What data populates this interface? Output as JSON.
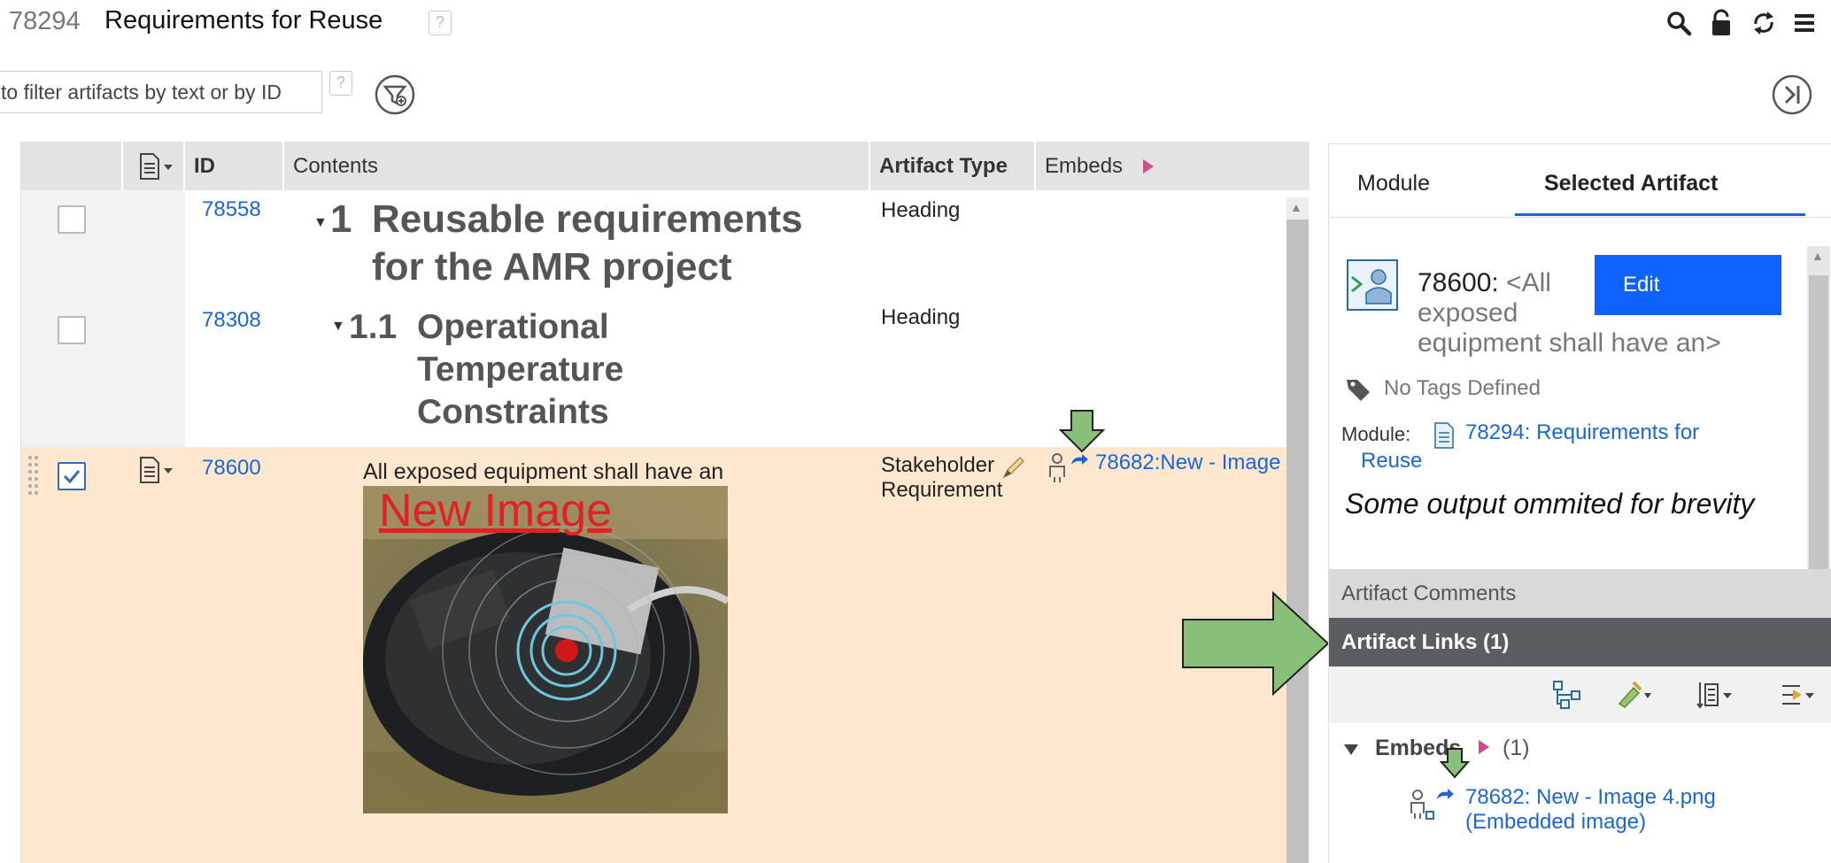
{
  "header": {
    "module_id": "78294",
    "module_title": "Requirements for Reuse",
    "help_label": "?"
  },
  "filter": {
    "placeholder": "to filter artifacts by text or by ID",
    "help_label": "?"
  },
  "grid": {
    "columns": {
      "id": "ID",
      "contents": "Contents",
      "artifact_type": "Artifact Type",
      "embeds": "Embeds"
    },
    "rows": [
      {
        "id": "78558",
        "number": "1",
        "text_line1": "Reusable requirements",
        "text_line2": "for the AMR project",
        "type": "Heading",
        "checked": false
      },
      {
        "id": "78308",
        "number": "1.1",
        "text_line1": "Operational",
        "text_line2": "Temperature",
        "text_line3": "Constraints",
        "type": "Heading",
        "checked": false
      },
      {
        "id": "78600",
        "text": "All exposed equipment shall have an",
        "image_caption": "New Image",
        "type_line1": "Stakeholder",
        "type_line2": "Requirement",
        "embed_link": "78682:New - Image",
        "checked": true
      }
    ]
  },
  "panel": {
    "tabs": [
      "Module",
      "Selected Artifact"
    ],
    "active_tab": "Selected Artifact",
    "artifact": {
      "id_label": "78600:",
      "title_part1": "<All",
      "title_part2": "exposed",
      "title_part3": "equipment shall have an>",
      "edit_label": "Edit",
      "no_tags": "No Tags Defined",
      "module_label": "Module:",
      "module_link_line1": "78294: Requirements for",
      "module_link_line2": "Reuse",
      "note": "Some output ommited for brevity"
    },
    "comments_label": "Artifact Comments",
    "links_label": "Artifact Links (1)",
    "embeds": {
      "label": "Embeds",
      "count": "(1)",
      "item_line1": "78682: New - Image 4.png",
      "item_line2": "(Embedded image)"
    }
  },
  "colors": {
    "accent": "#1a66d6",
    "edit_button": "#0f62fe",
    "selected_row": "#fde8cf",
    "annotation_arrow": "#88c07a",
    "links_bar": "#5a5e62",
    "embeds_marker": "#d14b8f"
  }
}
